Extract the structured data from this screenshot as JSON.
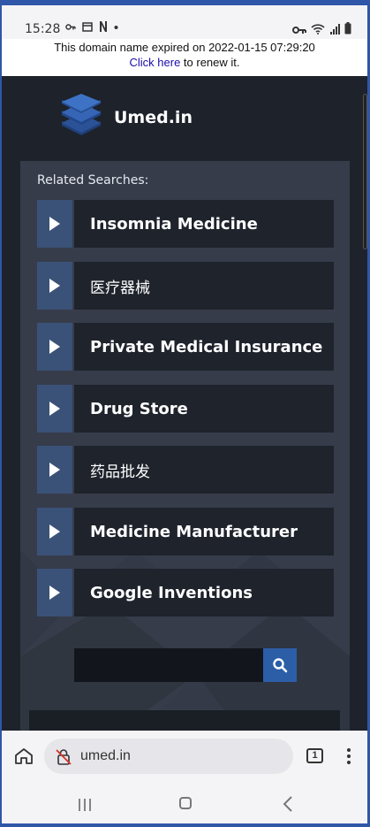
{
  "status": {
    "time": "15:28",
    "notification_icons": [
      "key-icon",
      "window-icon",
      "netflix-n-icon",
      "dot-icon"
    ],
    "system_icons": [
      "vpn-key-icon",
      "wifi-icon",
      "signal-icon",
      "battery-icon"
    ]
  },
  "notice": {
    "expired_text": "This domain name expired on 2022-01-15 07:29:20",
    "link_text": "Click here",
    "renew_text": " to renew it."
  },
  "site": {
    "brand": "Umed.in",
    "logo_icon": "stacked-layers-icon"
  },
  "related": {
    "title": "Related Searches:",
    "items": [
      {
        "label": "Insomnia Medicine"
      },
      {
        "label": "医疗器械"
      },
      {
        "label": "Private Medical Insurance"
      },
      {
        "label": "Drug Store"
      },
      {
        "label": "药品批发"
      },
      {
        "label": "Medicine Manufacturer"
      },
      {
        "label": "Google Inventions"
      }
    ]
  },
  "search": {
    "value": "",
    "placeholder": "",
    "button_icon": "search-icon"
  },
  "browser": {
    "url": "umed.in",
    "tab_count": "1",
    "icons": [
      "home-icon",
      "not-secure-icon",
      "tabs-icon",
      "more-vert-icon"
    ]
  },
  "navbar": {
    "icons": [
      "recents-icon",
      "home-icon",
      "back-icon"
    ]
  },
  "colors": {
    "accent": "#2c5ea8",
    "page_bg": "#1d222b",
    "panel_bg": "#363c4a",
    "item_bg": "#1e232c",
    "arrow_bg": "#3b5278",
    "link": "#1a0dab"
  }
}
